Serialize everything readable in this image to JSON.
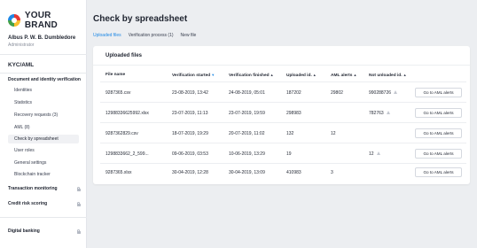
{
  "brand": {
    "name": "YOUR BRAND"
  },
  "user": {
    "name": "Albus P. W. B. Dumbledore",
    "role": "Administrator"
  },
  "sidebar": {
    "section": "KYC/AML",
    "group": "Document and identity verification",
    "items": [
      {
        "label": "Identities"
      },
      {
        "label": "Statistics"
      },
      {
        "label": "Recovery requests (3)"
      },
      {
        "label": "AML (8)"
      },
      {
        "label": "Check by spreadsheet"
      },
      {
        "label": "User roles"
      },
      {
        "label": "General settings"
      },
      {
        "label": "Blockchain tracker"
      }
    ],
    "locked": [
      {
        "label": "Transaction monitoring"
      },
      {
        "label": "Credit risk scoring"
      },
      {
        "label": "Digital banking"
      }
    ]
  },
  "page": {
    "title": "Check by spreadsheet"
  },
  "tabs": [
    {
      "label": "Uploaded files",
      "active": true
    },
    {
      "label": "Verification process (1)",
      "active": false
    },
    {
      "label": "New file",
      "active": false
    }
  ],
  "table": {
    "title": "Uploaded files",
    "columns": [
      "File name",
      "Verification started",
      "Verification finished",
      "Uploaded id.",
      "AML alerts",
      "Not unloaded id."
    ],
    "button_label": "Go to AML alerts",
    "rows": [
      {
        "file": "9287365.csv",
        "started": "23-08-2019, 13:42",
        "finished": "24-08-2019, 05:01",
        "uploaded": "187202",
        "alerts": "29802",
        "not_unloaded": "990288726"
      },
      {
        "file": "12988336625992.xlsx",
        "started": "23-07-2019, 11:13",
        "finished": "23-07-2019, 19:59",
        "uploaded": "298983",
        "alerts": "",
        "not_unloaded": "782763"
      },
      {
        "file": "9287362829.csv",
        "started": "18-07-2019, 19:29",
        "finished": "20-07-2019, 11:02",
        "uploaded": "132",
        "alerts": "12",
        "not_unloaded": ""
      },
      {
        "file": "1298833662_2_599...",
        "started": "09-06-2019, 03:53",
        "finished": "10-06-2019, 13:29",
        "uploaded": "19",
        "alerts": "",
        "not_unloaded": "12"
      },
      {
        "file": "9287365.xlsx",
        "started": "30-04-2019, 12:28",
        "finished": "30-04-2019, 13:09",
        "uploaded": "410983",
        "alerts": "3",
        "not_unloaded": ""
      }
    ]
  }
}
